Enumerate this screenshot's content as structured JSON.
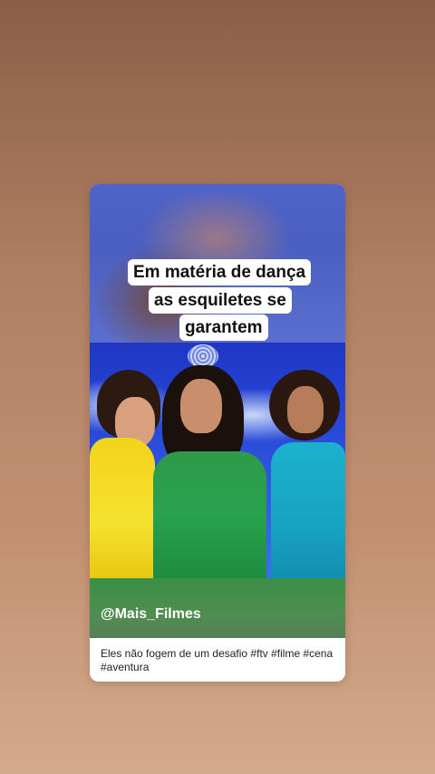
{
  "story": {
    "caption_lines": [
      "Em matéria de dança",
      "as esquiletes se",
      "garantem"
    ],
    "handle": "@Mais_Filmes",
    "description": "Eles não fogem de um desafio #ftv #filme #cena #aventura"
  },
  "colors": {
    "background_top": "#8a5f48",
    "background_bottom": "#d4aa8c",
    "card_bg": "#ffffff",
    "caption_bg": "#ffffff",
    "caption_text": "#111111",
    "handle_text": "#ffffff"
  },
  "media": {
    "scene": "three women in yellow, green and teal dresses dancing",
    "image_name": "movie-scene-image"
  }
}
